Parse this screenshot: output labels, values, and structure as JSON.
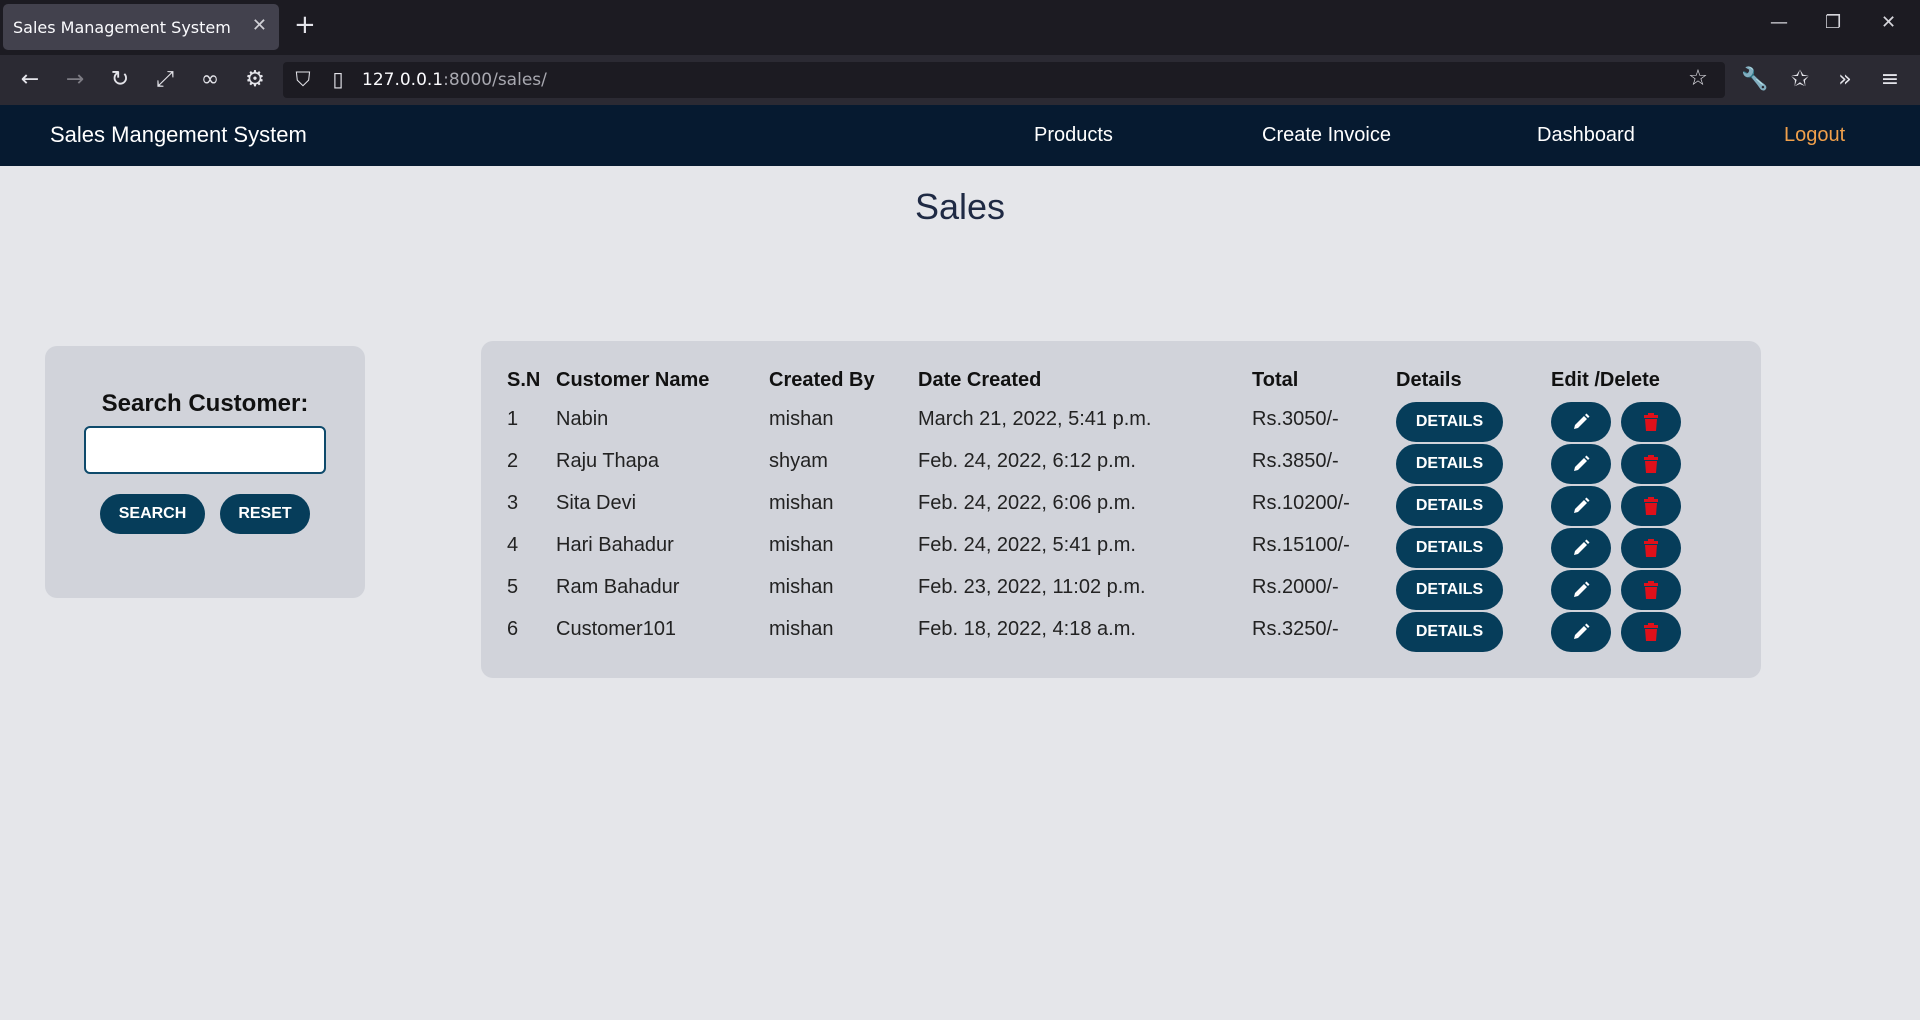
{
  "browser": {
    "tab_title": "Sales Management System",
    "tab_close": "✕",
    "new_tab": "+",
    "url_host": "127.0.0.1",
    "url_path": ":8000/sales/",
    "window_controls": {
      "minimize": "—",
      "restore": "❐",
      "close": "✕"
    }
  },
  "navbar": {
    "brand": "Sales Mangement System",
    "links": [
      "Products",
      "Create Invoice",
      "Dashboard"
    ],
    "logout": "Logout"
  },
  "page": {
    "title": "Sales"
  },
  "search": {
    "label": "Search Customer:",
    "input_value": "",
    "search_button": "SEARCH",
    "reset_button": "RESET"
  },
  "table": {
    "headers": [
      "S.N",
      "Customer Name",
      "Created By",
      "Date Created",
      "Total",
      "Details",
      "Edit /Delete"
    ],
    "details_label": "DETAILS",
    "rows": [
      {
        "sn": "1",
        "customer": "Nabin",
        "created_by": "mishan",
        "date": "March 21, 2022, 5:41 p.m.",
        "total": "Rs.3050/-"
      },
      {
        "sn": "2",
        "customer": "Raju Thapa",
        "created_by": "shyam",
        "date": "Feb. 24, 2022, 6:12 p.m.",
        "total": "Rs.3850/-"
      },
      {
        "sn": "3",
        "customer": "Sita Devi",
        "created_by": "mishan",
        "date": "Feb. 24, 2022, 6:06 p.m.",
        "total": "Rs.10200/-"
      },
      {
        "sn": "4",
        "customer": "Hari Bahadur",
        "created_by": "mishan",
        "date": "Feb. 24, 2022, 5:41 p.m.",
        "total": "Rs.15100/-"
      },
      {
        "sn": "5",
        "customer": "Ram Bahadur",
        "created_by": "mishan",
        "date": "Feb. 23, 2022, 11:02 p.m.",
        "total": "Rs.2000/-"
      },
      {
        "sn": "6",
        "customer": "Customer101",
        "created_by": "mishan",
        "date": "Feb. 18, 2022, 4:18 a.m.",
        "total": "Rs.3250/-"
      }
    ]
  },
  "colors": {
    "navbar_bg": "#061a30",
    "button_bg": "#063d5a",
    "logout": "#f0a04b",
    "delete_icon": "#e0101a",
    "page_bg": "#e5e6ea",
    "card_bg": "#d1d3da"
  }
}
